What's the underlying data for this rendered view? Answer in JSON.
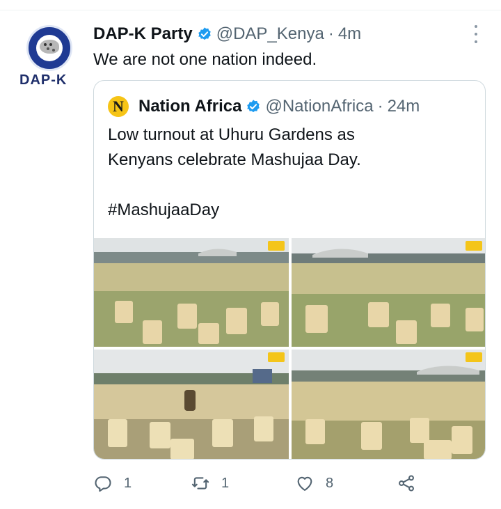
{
  "tweet": {
    "author": {
      "avatar_text": "DAP-K",
      "display_name": "DAP-K Party",
      "handle": "@DAP_Kenya",
      "time": "4m"
    },
    "text": "We are not one nation indeed.",
    "quoted": {
      "avatar_letter": "N",
      "display_name": "Nation Africa",
      "handle": "@NationAfrica",
      "time": "24m",
      "text": "Low turnout at Uhuru Gardens as\nKenyans celebrate Mashujaa Day.\n\n#MashujaaDay"
    },
    "actions": {
      "replies": "1",
      "retweets": "1",
      "likes": "8"
    }
  },
  "icons": {
    "verified": "verified-badge-icon",
    "more": "more-vertical-icon",
    "reply": "reply-icon",
    "retweet": "retweet-icon",
    "like": "heart-icon",
    "share": "share-icon"
  },
  "colors": {
    "verified": "#1d9bf0",
    "muted": "#536471",
    "border": "#cfd9de",
    "chairs": "#e8d6a8"
  }
}
